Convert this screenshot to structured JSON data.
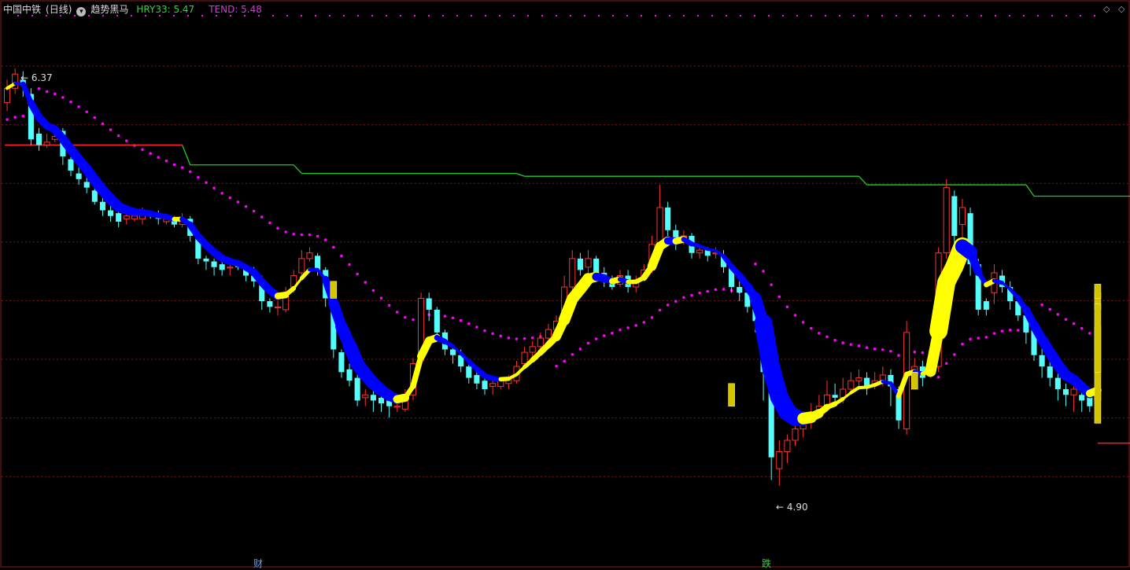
{
  "header": {
    "symbol": "中国中铁",
    "period": "(日线)",
    "indicator": "趋势黑马",
    "hry_label": "HRY33: 5.47",
    "tend_label": "TEND: 5.48",
    "hry_color": "#39d339",
    "tend_color": "#d23cd2"
  },
  "icons": {
    "dropdown": "chevron-down-icon",
    "diamond": "diamond-icon"
  },
  "markers": [
    {
      "name": "high-marker",
      "text": "6.37"
    },
    {
      "name": "low-marker",
      "text": "4.90"
    }
  ],
  "events": [
    {
      "name": "event-finance",
      "text": "财",
      "color": "#5aa0ff"
    },
    {
      "name": "event-drop",
      "text": "跌",
      "color": "#39d339"
    }
  ],
  "chart_data": {
    "type": "line",
    "title": "",
    "xlabel": "",
    "ylabel": "",
    "ylim": [
      4.7,
      6.55
    ],
    "grid": true,
    "colors": {
      "up": "#ff3232",
      "down": "#54fcfc",
      "ribbon_up": "#ffff00",
      "ribbon_down": "#0000ff",
      "dots": "#ff00ff"
    },
    "high": 6.37,
    "low": 4.9,
    "candles": [
      [
        6.25,
        6.3,
        6.33,
        6.22
      ],
      [
        6.3,
        6.35,
        6.37,
        6.28
      ],
      [
        6.33,
        6.31,
        6.36,
        6.27
      ],
      [
        6.28,
        6.12,
        6.3,
        6.1
      ],
      [
        6.14,
        6.1,
        6.16,
        6.08
      ],
      [
        6.1,
        6.11,
        6.14,
        6.09
      ],
      [
        6.12,
        6.13,
        6.17,
        6.11
      ],
      [
        6.15,
        6.06,
        6.16,
        6.03
      ],
      [
        6.05,
        6.01,
        6.07,
        5.99
      ],
      [
        6.0,
        5.98,
        6.02,
        5.96
      ],
      [
        5.97,
        5.95,
        5.99,
        5.93
      ],
      [
        5.94,
        5.9,
        5.96,
        5.89
      ],
      [
        5.9,
        5.87,
        5.92,
        5.85
      ],
      [
        5.87,
        5.85,
        5.89,
        5.83
      ],
      [
        5.86,
        5.83,
        5.87,
        5.81
      ],
      [
        5.84,
        5.85,
        5.86,
        5.82
      ],
      [
        5.84,
        5.85,
        5.86,
        5.83
      ],
      [
        5.84,
        5.86,
        5.88,
        5.82
      ],
      [
        5.86,
        5.85,
        5.87,
        5.84
      ],
      [
        5.86,
        5.84,
        5.87,
        5.82
      ],
      [
        5.83,
        5.84,
        5.85,
        5.82
      ],
      [
        5.84,
        5.82,
        5.85,
        5.81
      ],
      [
        5.82,
        5.84,
        5.86,
        5.81
      ],
      [
        5.84,
        5.78,
        5.85,
        5.76
      ],
      [
        5.78,
        5.7,
        5.79,
        5.68
      ],
      [
        5.7,
        5.69,
        5.71,
        5.66
      ],
      [
        5.69,
        5.67,
        5.7,
        5.64
      ],
      [
        5.68,
        5.66,
        5.7,
        5.64
      ],
      [
        5.67,
        5.67,
        5.69,
        5.64
      ],
      [
        5.68,
        5.67,
        5.69,
        5.66
      ],
      [
        5.67,
        5.64,
        5.68,
        5.62
      ],
      [
        5.64,
        5.62,
        5.67,
        5.6
      ],
      [
        5.62,
        5.55,
        5.64,
        5.52
      ],
      [
        5.55,
        5.53,
        5.56,
        5.51
      ],
      [
        5.53,
        5.53,
        5.55,
        5.5
      ],
      [
        5.52,
        5.58,
        5.6,
        5.51
      ],
      [
        5.6,
        5.64,
        5.66,
        5.58
      ],
      [
        5.65,
        5.7,
        5.73,
        5.64
      ],
      [
        5.7,
        5.72,
        5.74,
        5.69
      ],
      [
        5.71,
        5.66,
        5.72,
        5.64
      ],
      [
        5.66,
        5.56,
        5.67,
        5.53
      ],
      [
        5.56,
        5.38,
        5.57,
        5.35
      ],
      [
        5.37,
        5.3,
        5.38,
        5.28
      ],
      [
        5.31,
        5.27,
        5.33,
        5.25
      ],
      [
        5.28,
        5.2,
        5.3,
        5.18
      ],
      [
        5.21,
        5.22,
        5.24,
        5.18
      ],
      [
        5.22,
        5.2,
        5.26,
        5.16
      ],
      [
        5.21,
        5.19,
        5.24,
        5.16
      ],
      [
        5.2,
        5.18,
        5.22,
        5.14
      ],
      [
        5.18,
        5.18,
        5.2,
        5.16
      ],
      [
        5.17,
        5.22,
        5.24,
        5.16
      ],
      [
        5.22,
        5.33,
        5.35,
        5.2
      ],
      [
        5.34,
        5.56,
        5.58,
        5.32
      ],
      [
        5.56,
        5.52,
        5.58,
        5.48
      ],
      [
        5.52,
        5.44,
        5.53,
        5.42
      ],
      [
        5.44,
        5.38,
        5.45,
        5.36
      ],
      [
        5.38,
        5.36,
        5.39,
        5.33
      ],
      [
        5.36,
        5.32,
        5.38,
        5.3
      ],
      [
        5.32,
        5.28,
        5.34,
        5.26
      ],
      [
        5.29,
        5.26,
        5.3,
        5.24
      ],
      [
        5.27,
        5.24,
        5.28,
        5.22
      ],
      [
        5.25,
        5.26,
        5.27,
        5.22
      ],
      [
        5.25,
        5.27,
        5.28,
        5.24
      ],
      [
        5.26,
        5.28,
        5.29,
        5.24
      ],
      [
        5.27,
        5.32,
        5.34,
        5.26
      ],
      [
        5.33,
        5.37,
        5.39,
        5.31
      ],
      [
        5.37,
        5.39,
        5.41,
        5.35
      ],
      [
        5.39,
        5.42,
        5.44,
        5.37
      ],
      [
        5.42,
        5.45,
        5.47,
        5.41
      ],
      [
        5.45,
        5.48,
        5.5,
        5.44
      ],
      [
        5.49,
        5.6,
        5.64,
        5.47
      ],
      [
        5.6,
        5.7,
        5.73,
        5.58
      ],
      [
        5.7,
        5.66,
        5.72,
        5.64
      ],
      [
        5.67,
        5.7,
        5.73,
        5.65
      ],
      [
        5.7,
        5.65,
        5.71,
        5.62
      ],
      [
        5.65,
        5.62,
        5.67,
        5.6
      ],
      [
        5.62,
        5.6,
        5.64,
        5.59
      ],
      [
        5.61,
        5.64,
        5.66,
        5.6
      ],
      [
        5.64,
        5.6,
        5.66,
        5.58
      ],
      [
        5.6,
        5.62,
        5.64,
        5.58
      ],
      [
        5.63,
        5.66,
        5.68,
        5.62
      ],
      [
        5.66,
        5.75,
        5.78,
        5.65
      ],
      [
        5.75,
        5.88,
        5.96,
        5.74
      ],
      [
        5.88,
        5.8,
        5.9,
        5.78
      ],
      [
        5.8,
        5.76,
        5.82,
        5.73
      ],
      [
        5.77,
        5.78,
        5.8,
        5.75
      ],
      [
        5.78,
        5.72,
        5.79,
        5.7
      ],
      [
        5.72,
        5.73,
        5.75,
        5.7
      ],
      [
        5.73,
        5.71,
        5.74,
        5.69
      ],
      [
        5.72,
        5.72,
        5.74,
        5.7
      ],
      [
        5.71,
        5.67,
        5.73,
        5.65
      ],
      [
        5.67,
        5.6,
        5.68,
        5.58
      ],
      [
        5.6,
        5.58,
        5.62,
        5.55
      ],
      [
        5.58,
        5.53,
        5.6,
        5.51
      ],
      [
        5.53,
        5.48,
        5.55,
        5.44
      ],
      [
        5.48,
        5.3,
        5.5,
        5.2
      ],
      [
        5.3,
        5.0,
        5.32,
        4.92
      ],
      [
        4.96,
        5.02,
        5.06,
        4.9
      ],
      [
        5.02,
        5.06,
        5.08,
        4.98
      ],
      [
        5.06,
        5.1,
        5.13,
        5.04
      ],
      [
        5.1,
        5.13,
        5.16,
        5.07
      ],
      [
        5.13,
        5.15,
        5.19,
        5.1
      ],
      [
        5.16,
        5.18,
        5.22,
        5.14
      ],
      [
        5.18,
        5.22,
        5.27,
        5.16
      ],
      [
        5.22,
        5.21,
        5.26,
        5.19
      ],
      [
        5.21,
        5.24,
        5.28,
        5.19
      ],
      [
        5.24,
        5.27,
        5.3,
        5.22
      ],
      [
        5.27,
        5.28,
        5.31,
        5.25
      ],
      [
        5.28,
        5.25,
        5.3,
        5.22
      ],
      [
        5.26,
        5.27,
        5.3,
        5.24
      ],
      [
        5.27,
        5.29,
        5.32,
        5.25
      ],
      [
        5.29,
        5.25,
        5.31,
        5.18
      ],
      [
        5.24,
        5.13,
        5.25,
        5.1
      ],
      [
        5.1,
        5.44,
        5.48,
        5.08
      ],
      [
        5.3,
        5.32,
        5.35,
        5.28
      ],
      [
        5.32,
        5.28,
        5.34,
        5.25
      ],
      [
        5.3,
        5.32,
        5.35,
        5.28
      ],
      [
        5.32,
        5.72,
        5.74,
        5.3
      ],
      [
        5.72,
        5.95,
        5.98,
        5.7
      ],
      [
        5.92,
        5.78,
        5.94,
        5.74
      ],
      [
        5.82,
        5.88,
        5.91,
        5.72
      ],
      [
        5.86,
        5.68,
        5.88,
        5.64
      ],
      [
        5.68,
        5.52,
        5.7,
        5.5
      ],
      [
        5.55,
        5.52,
        5.56,
        5.5
      ],
      [
        5.58,
        5.65,
        5.68,
        5.54
      ],
      [
        5.64,
        5.6,
        5.66,
        5.58
      ],
      [
        5.6,
        5.55,
        5.62,
        5.52
      ],
      [
        5.55,
        5.5,
        5.57,
        5.48
      ],
      [
        5.5,
        5.44,
        5.52,
        5.4
      ],
      [
        5.45,
        5.36,
        5.47,
        5.34
      ],
      [
        5.36,
        5.32,
        5.4,
        5.28
      ],
      [
        5.32,
        5.28,
        5.34,
        5.25
      ],
      [
        5.28,
        5.24,
        5.3,
        5.2
      ],
      [
        5.24,
        5.22,
        5.26,
        5.18
      ],
      [
        5.22,
        5.24,
        5.27,
        5.16
      ],
      [
        5.22,
        5.2,
        5.25,
        5.16
      ],
      [
        5.22,
        5.18,
        5.24,
        5.16
      ],
      [
        5.2,
        5.26,
        5.32,
        5.17
      ]
    ],
    "yellow_bars": [
      [
        70,
        5.52,
        5.6
      ],
      [
        98,
        5.43,
        5.51
      ],
      [
        122,
        5.7,
        5.78
      ],
      [
        127,
        5.51,
        5.61
      ],
      [
        147,
        5.3,
        5.37
      ]
    ],
    "big_yellow_bars": [
      [
        196,
        5.34,
        5.38
      ],
      [
        248,
        5.16,
        5.21
      ],
      [
        288,
        5.65,
        5.72
      ],
      [
        317,
        5.38,
        5.46
      ],
      [
        357,
        5.45,
        5.54
      ],
      [
        469,
        5.18,
        5.23
      ],
      [
        655,
        5.29,
        5.33
      ]
    ],
    "hry33_line": [
      [
        0,
        6.1
      ],
      [
        22,
        6.1
      ],
      [
        23,
        6.03
      ],
      [
        36,
        6.03
      ],
      [
        37,
        6.0
      ],
      [
        64,
        6.0
      ],
      [
        65,
        5.99
      ],
      [
        107,
        5.99
      ],
      [
        108,
        5.96
      ],
      [
        128,
        5.96
      ],
      [
        129,
        5.92
      ],
      [
        158,
        5.92
      ],
      [
        159,
        5.87
      ],
      [
        163,
        5.87
      ],
      [
        164,
        5.75
      ],
      [
        173,
        5.75
      ],
      [
        174,
        5.72
      ],
      [
        196,
        5.72
      ],
      [
        197,
        5.65
      ],
      [
        252,
        5.65
      ],
      [
        253,
        5.51
      ],
      [
        266,
        5.51
      ],
      [
        267,
        5.45
      ],
      [
        300,
        5.45
      ],
      [
        301,
        5.4
      ],
      [
        311,
        5.4
      ],
      [
        312,
        5.3
      ],
      [
        331,
        5.3
      ],
      [
        332,
        5.36
      ],
      [
        344,
        5.36
      ],
      [
        345,
        5.35
      ],
      [
        386,
        5.35
      ],
      [
        387,
        5.05
      ],
      [
        466,
        5.05
      ],
      [
        467,
        5.04
      ],
      [
        474,
        5.04
      ]
    ],
    "hry33_red_segments": [
      [
        280,
        5.45,
        300
      ],
      [
        311,
        5.45,
        386
      ],
      [
        464,
        5.04,
        474
      ]
    ],
    "dots_scale": 1.0
  }
}
